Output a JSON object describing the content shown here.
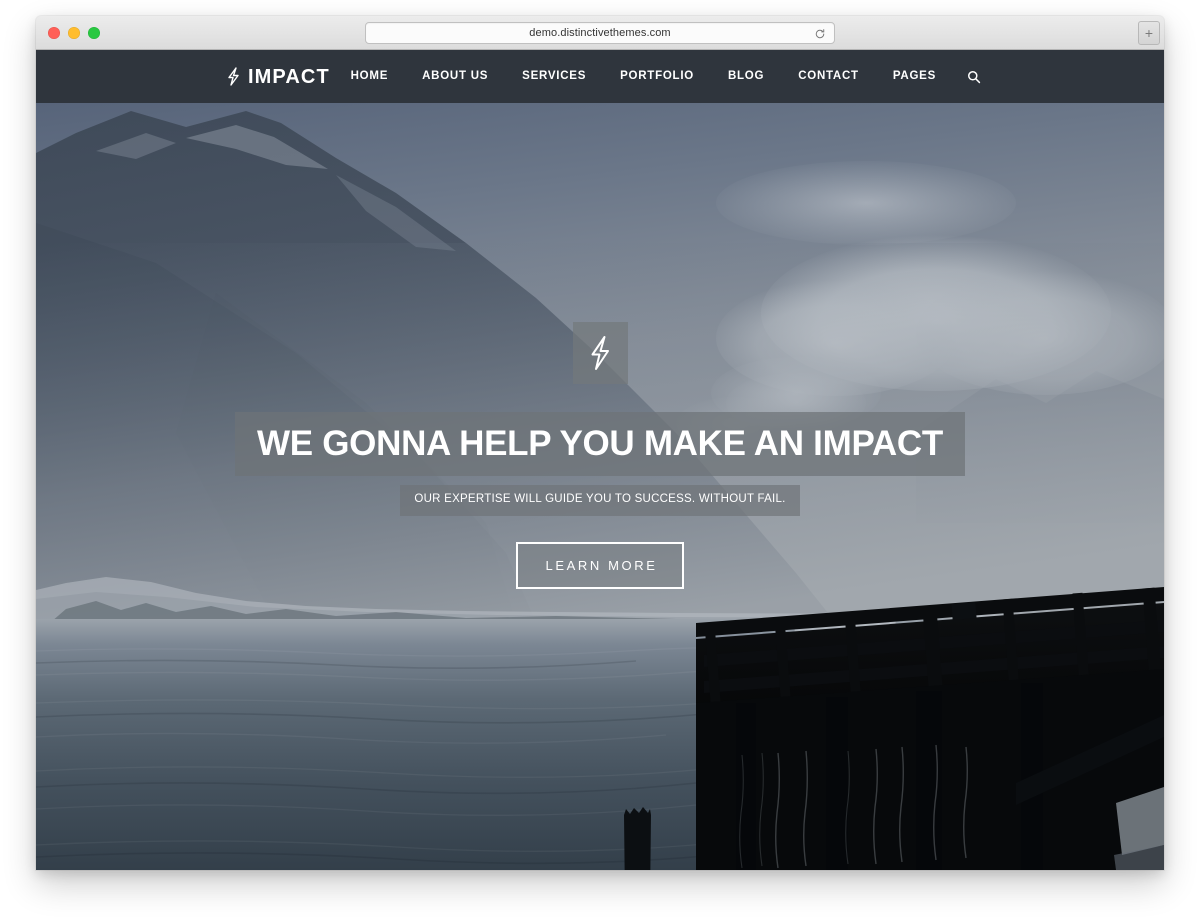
{
  "browser": {
    "url": "demo.distinctivethemes.com",
    "reload_icon": "reload-icon",
    "new_tab_label": "+",
    "traffic_lights": [
      {
        "name": "close",
        "color": "#ff5f57"
      },
      {
        "name": "minimize",
        "color": "#ffbd2e"
      },
      {
        "name": "maximize",
        "color": "#28c840"
      }
    ]
  },
  "site": {
    "nav": {
      "brand": {
        "text": "IMPACT",
        "icon": "lightning-bolt-icon"
      },
      "background_color": "#2f353d",
      "items": [
        {
          "label": "HOME"
        },
        {
          "label": "ABOUT US"
        },
        {
          "label": "SERVICES"
        },
        {
          "label": "PORTFOLIO"
        },
        {
          "label": "BLOG"
        },
        {
          "label": "CONTACT"
        },
        {
          "label": "PAGES"
        }
      ],
      "search_icon": "search-icon"
    },
    "hero": {
      "badge_icon": "lightning-bolt-icon",
      "title": "WE GONNA HELP YOU MAKE AN IMPACT",
      "subtitle": "OUR EXPERTISE WILL GUIDE YOU TO SUCCESS. WITHOUT FAIL.",
      "cta_label": "LEARN MORE",
      "overlay_color": "#6e7377",
      "text_color": "#ffffff",
      "image_description": "Hazy lake at dusk with a dark mountain ridge on the left, soft clouds in a blue-gray sky, a silhouetted wooden pier on the right and a lone piling in the calm water"
    }
  }
}
